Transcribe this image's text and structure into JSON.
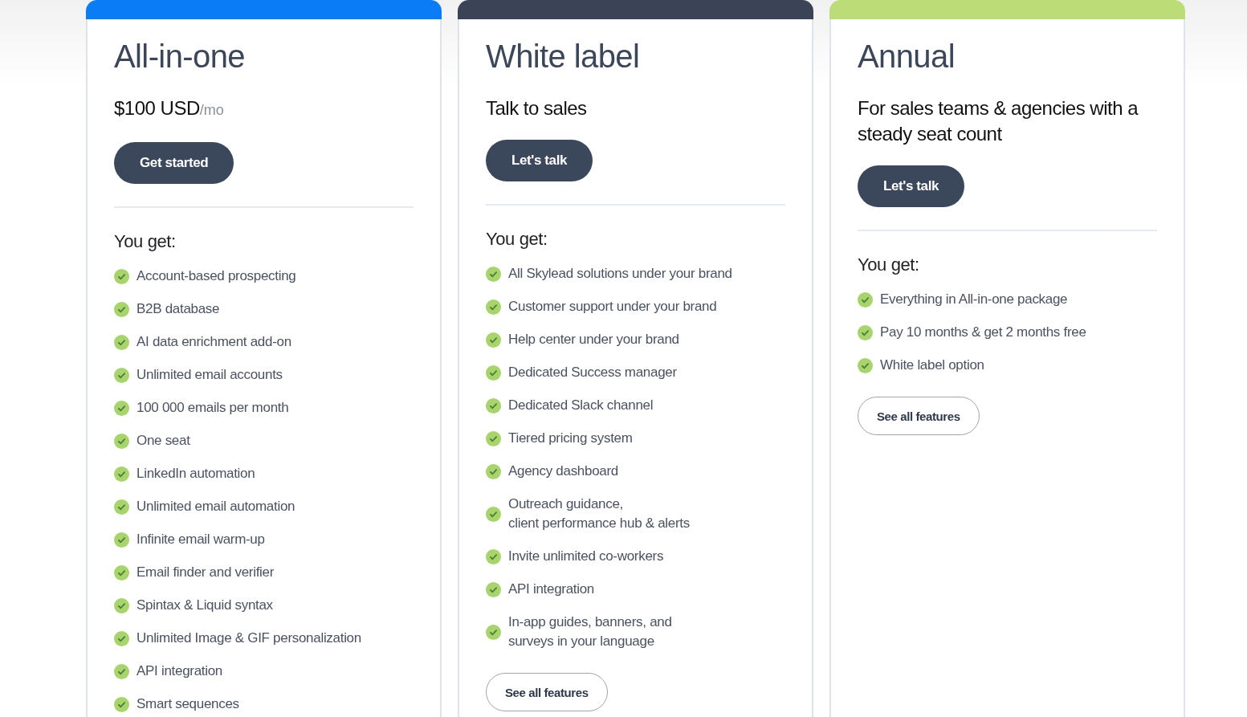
{
  "plans": [
    {
      "name": "All-in-one",
      "color": "#0a7cf5",
      "price": {
        "amount": "$100 USD",
        "period": "/mo"
      },
      "cta": "Get started",
      "features_heading": "You get:",
      "features": [
        "Account-based prospecting",
        "B2B database",
        "AI data enrichment add-on",
        "Unlimited email accounts",
        "100 000 emails per month",
        "One seat",
        "LinkedIn automation",
        "Unlimited email automation",
        "Infinite email warm-up",
        "Email finder and verifier",
        "Spintax & Liquid syntax",
        "Unlimited Image & GIF personalization",
        "API integration",
        "Smart sequences"
      ]
    },
    {
      "name": "White label",
      "color": "#3a4456",
      "tagline": "Talk to sales",
      "cta": "Let's talk",
      "features_heading": "You get:",
      "features": [
        "All Skylead solutions under your brand",
        "Customer support under your brand",
        "Help center under your brand",
        "Dedicated Success manager",
        "Dedicated Slack channel",
        "Tiered pricing system",
        "Agency dashboard",
        "Outreach guidance,\nclient performance hub & alerts",
        "Invite unlimited co-workers",
        "API integration",
        "In-app guides, banners, and\nsurveys in your language"
      ],
      "secondary_button": "See all features"
    },
    {
      "name": "Annual",
      "color": "#bbdc77",
      "tagline": "For sales teams & agencies with a steady seat count",
      "cta": "Let's talk",
      "features_heading": "You get:",
      "features": [
        "Everything in All-in-one package",
        "Pay 10 months & get 2 months free",
        "White label option"
      ],
      "secondary_button": "See all features"
    }
  ]
}
